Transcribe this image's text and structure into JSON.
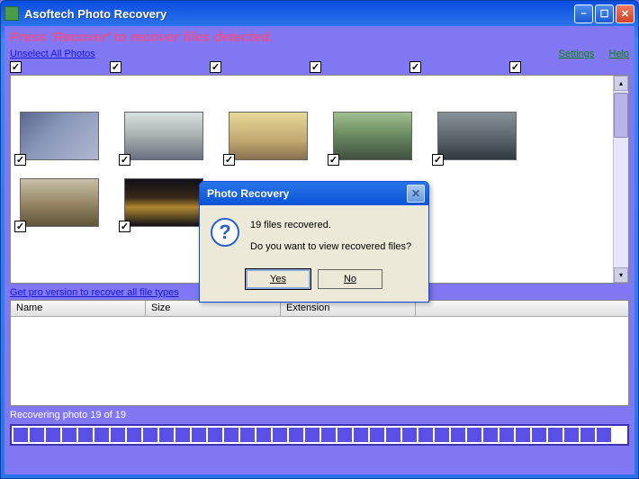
{
  "window": {
    "title": "Asoftech Photo Recovery"
  },
  "instruction": "Press 'Recover' to recover files detected.",
  "links": {
    "unselect": "Unselect All Photos",
    "settings": "Settings",
    "help": "Help",
    "pro": "Get pro version to recover all file types"
  },
  "columns": {
    "name": "Name",
    "size": "Size",
    "extension": "Extension"
  },
  "status": "Recovering photo 19 of 19",
  "dialog": {
    "title": "Photo Recovery",
    "line1": "19 files recovered.",
    "line2": "Do you want to view recovered files?",
    "yes": "Yes",
    "no": "No"
  },
  "checkmark": "✓"
}
